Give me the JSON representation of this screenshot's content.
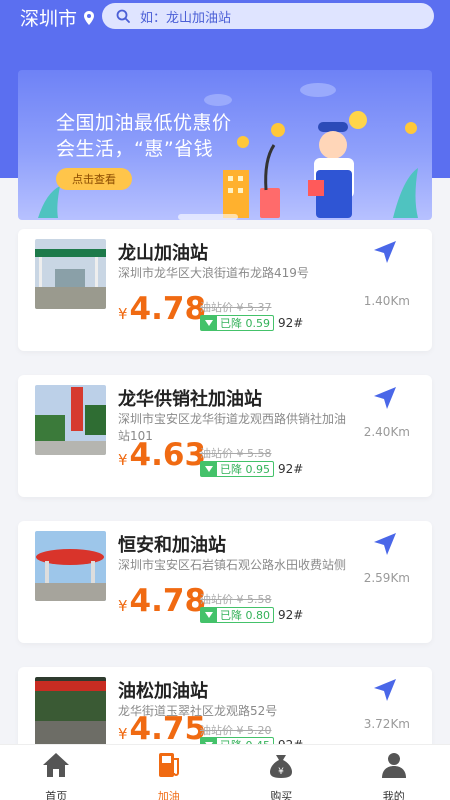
{
  "header": {
    "city": "深圳市",
    "search_placeholder": "如：龙山加油站"
  },
  "banner": {
    "line1": "全国加油最低优惠价",
    "line2": "会生活，“惠”省钱",
    "button": "点击查看"
  },
  "stations": [
    {
      "name": "龙山加油站",
      "address": "深圳市龙华区大浪街道布龙路419号",
      "price_symbol": "¥",
      "price": "4.78",
      "original_price": "油站价 ¥ 5.37",
      "drop": "已降 0.59",
      "grade": "92#",
      "distance": "1.40Km"
    },
    {
      "name": "龙华供销社加油站",
      "address": "深圳市宝安区龙华街道龙观西路供销社加油站101",
      "price_symbol": "¥",
      "price": "4.63",
      "original_price": "油站价 ¥ 5.58",
      "drop": "已降 0.95",
      "grade": "92#",
      "distance": "2.40Km"
    },
    {
      "name": "恒安和加油站",
      "address": "深圳市宝安区石岩镇石观公路水田收费站侧",
      "price_symbol": "¥",
      "price": "4.78",
      "original_price": "油站价 ¥ 5.58",
      "drop": "已降 0.80",
      "grade": "92#",
      "distance": "2.59Km"
    },
    {
      "name": "油松加油站",
      "address": "龙华街道玉翠社区龙观路52号",
      "price_symbol": "¥",
      "price": "4.75",
      "original_price": "油站价 ¥ 5.20",
      "drop": "已降 0.45",
      "grade": "92#",
      "distance": "3.72Km"
    }
  ],
  "tabs": [
    {
      "label": "首页",
      "icon": "home-icon"
    },
    {
      "label": "加油",
      "icon": "fuel-pump-icon",
      "active": true
    },
    {
      "label": "购买",
      "icon": "money-bag-icon"
    },
    {
      "label": "我的",
      "icon": "user-icon"
    }
  ],
  "colors": {
    "primary": "#5b6ff0",
    "price": "#f06a12",
    "discount": "#44c26a",
    "nav": "#4a67e8"
  }
}
